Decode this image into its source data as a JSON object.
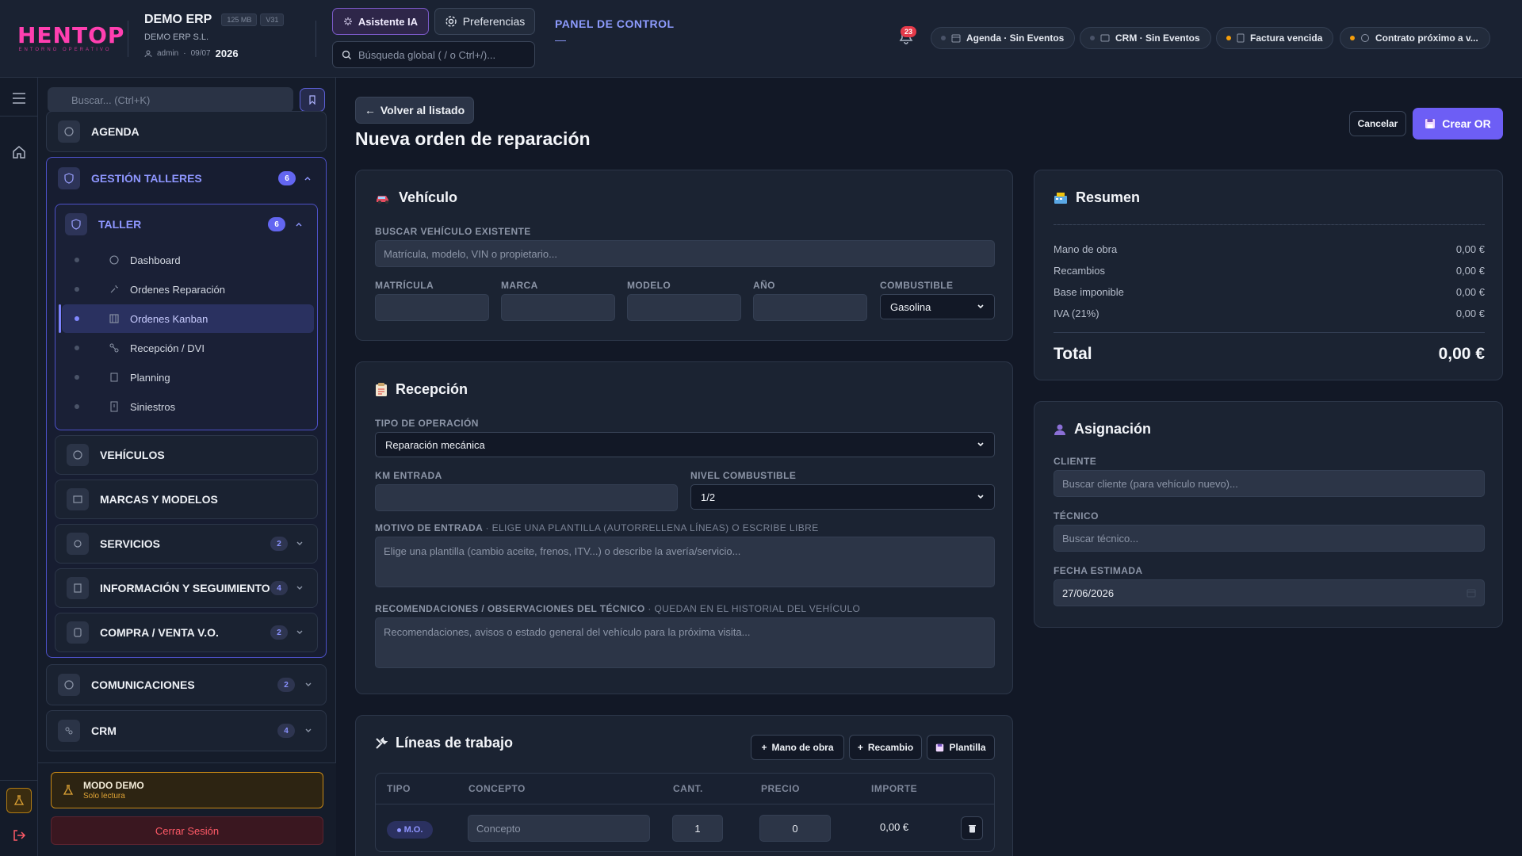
{
  "header": {
    "logo_text": "HENTOP",
    "logo_subtitle": "ENTORNO OPERATIVO",
    "company_name": "DEMO ERP",
    "size_tag": "125 MB",
    "version_tag": "V31",
    "company_legal": "DEMO ERP S.L.",
    "user": "admin",
    "date": "09/07",
    "year": "2026",
    "ai_button": "Asistente IA",
    "preferences_button": "Preferencias",
    "search_placeholder": "Búsqueda global ( / o Ctrl+/)...",
    "panel_title": "PANEL DE CONTROL",
    "panel_sub": "—",
    "notifications_count": "23",
    "chips": [
      {
        "label": "Agenda · Sin Eventos",
        "dot_color": "#4a5368"
      },
      {
        "label": "CRM · Sin Eventos",
        "dot_color": "#4a5368"
      },
      {
        "label": "Factura vencida",
        "dot_color": "#f59e0b"
      },
      {
        "label": "Contrato próximo a v...",
        "dot_color": "#f59e0b"
      }
    ]
  },
  "sidebar": {
    "search_placeholder": "Buscar... (Ctrl+K)",
    "agenda": "AGENDA",
    "gestion": {
      "label": "GESTIÓN TALLERES",
      "count": "6"
    },
    "taller": {
      "label": "TALLER",
      "count": "6",
      "items": [
        "Dashboard",
        "Ordenes Reparación",
        "Ordenes Kanban",
        "Recepción / DVI",
        "Planning",
        "Siniestros"
      ]
    },
    "vehiculos": "VEHÍCULOS",
    "marcas": "MARCAS Y MODELOS",
    "servicios": {
      "label": "SERVICIOS",
      "count": "2"
    },
    "informacion": {
      "label": "INFORMACIÓN Y SEGUIMIENTO",
      "count": "4"
    },
    "compra": {
      "label": "COMPRA / VENTA V.O.",
      "count": "2"
    },
    "comunicaciones": {
      "label": "COMUNICACIONES",
      "count": "2"
    },
    "crm": {
      "label": "CRM",
      "count": "4"
    },
    "demo_title": "MODO DEMO",
    "demo_sub": "Solo lectura",
    "logout": "Cerrar Sesión"
  },
  "main": {
    "back": "Volver al listado",
    "title": "Nueva orden de reparación",
    "cancel": "Cancelar",
    "create": "Crear OR",
    "vehiculo": {
      "title": "Vehículo",
      "search_label": "BUSCAR VEHÍCULO EXISTENTE",
      "search_placeholder": "Matrícula, modelo, VIN o propietario...",
      "matricula": "MATRÍCULA",
      "marca": "MARCA",
      "modelo": "MODELO",
      "anio": "AÑO",
      "combustible": "COMBUSTIBLE",
      "combustible_value": "Gasolina"
    },
    "recepcion": {
      "title": "Recepción",
      "tipo_label": "TIPO DE OPERACIÓN",
      "tipo_value": "Reparación mecánica",
      "km_label": "KM ENTRADA",
      "nivel_label": "NIVEL COMBUSTIBLE",
      "nivel_value": "1/2",
      "motivo_label": "MOTIVO DE ENTRADA",
      "motivo_hint": "· ELIGE UNA PLANTILLA (AUTORRELLENA LÍNEAS) O ESCRIBE LIBRE",
      "motivo_placeholder": "Elige una plantilla (cambio aceite, frenos, ITV...) o describe la avería/servicio...",
      "recom_label": "RECOMENDACIONES / OBSERVACIONES DEL TÉCNICO",
      "recom_hint": "· QUEDAN EN EL HISTORIAL DEL VEHÍCULO",
      "recom_placeholder": "Recomendaciones, avisos o estado general del vehículo para la próxima visita..."
    },
    "lineas": {
      "title": "Líneas de trabajo",
      "btn_mano": "Mano de obra",
      "btn_recambio": "Recambio",
      "btn_plantilla": "Plantilla",
      "columns": [
        "TIPO",
        "CONCEPTO",
        "CANT.",
        "PRECIO",
        "IMPORTE"
      ],
      "row": {
        "tipo": "M.O.",
        "concepto_placeholder": "Concepto",
        "cantidad": "1",
        "precio": "0",
        "importe": "0,00 €"
      }
    },
    "resumen": {
      "title": "Resumen",
      "rows": [
        {
          "label": "Mano de obra",
          "value": "0,00 €"
        },
        {
          "label": "Recambios",
          "value": "0,00 €"
        },
        {
          "label": "Base imponible",
          "value": "0,00 €"
        },
        {
          "label": "IVA (21%)",
          "value": "0,00 €"
        }
      ],
      "total_label": "Total",
      "total_value": "0,00 €"
    },
    "asignacion": {
      "title": "Asignación",
      "cliente_label": "CLIENTE",
      "cliente_placeholder": "Buscar cliente (para vehículo nuevo)...",
      "tecnico_label": "TÉCNICO",
      "tecnico_placeholder": "Buscar técnico...",
      "fecha_label": "FECHA ESTIMADA",
      "fecha_value": "27/06/2026"
    }
  },
  "colors": {
    "accent": "#6d5ef5",
    "brand": "#ff3fb0",
    "warning": "#f59e0b",
    "danger": "#ff5a67"
  }
}
